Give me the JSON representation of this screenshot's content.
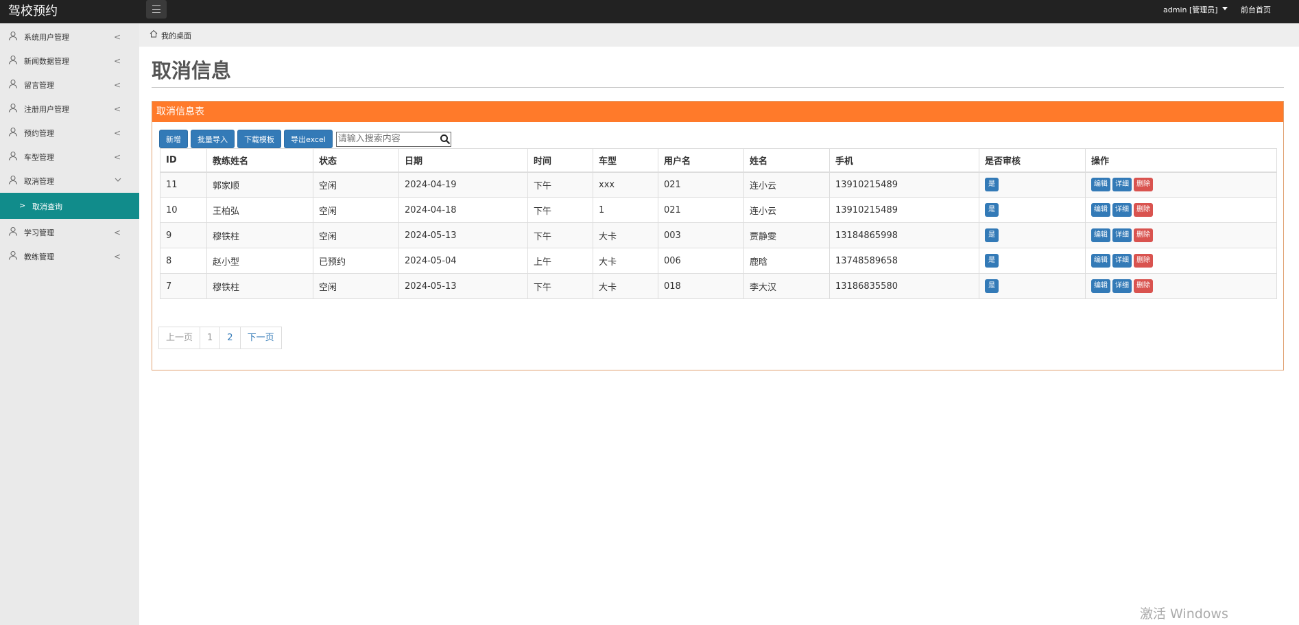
{
  "app": {
    "brand": "驾校预约"
  },
  "topbar": {
    "user": "admin [管理员]",
    "front_link": "前台首页"
  },
  "sidebar": {
    "items": [
      {
        "label": "系统用户管理"
      },
      {
        "label": "新闻数据管理"
      },
      {
        "label": "留言管理"
      },
      {
        "label": "注册用户管理"
      },
      {
        "label": "预约管理"
      },
      {
        "label": "车型管理"
      },
      {
        "label": "取消管理"
      },
      {
        "label": "学习管理"
      },
      {
        "label": "教练管理"
      }
    ],
    "sub_item": "取消查询"
  },
  "breadcrumb": {
    "home": "我的桌面"
  },
  "page": {
    "title": "取消信息"
  },
  "panel": {
    "heading": "取消信息表",
    "toolbar": {
      "add": "新增",
      "import": "批量导入",
      "template": "下载模板",
      "export": "导出excel"
    },
    "search": {
      "placeholder": "请输入搜索内容"
    }
  },
  "table": {
    "headers": [
      "ID",
      "教练姓名",
      "状态",
      "日期",
      "时间",
      "车型",
      "用户名",
      "姓名",
      "手机",
      "是否审核",
      "操作"
    ],
    "rows": [
      {
        "id": "11",
        "coach": "郭家顺",
        "status": "空闲",
        "date": "2024-04-19",
        "time": "下午",
        "car": "xxx",
        "username": "021",
        "name": "连小云",
        "phone": "13910215489",
        "approved": "是"
      },
      {
        "id": "10",
        "coach": "王柏弘",
        "status": "空闲",
        "date": "2024-04-18",
        "time": "下午",
        "car": "1",
        "username": "021",
        "name": "连小云",
        "phone": "13910215489",
        "approved": "是"
      },
      {
        "id": "9",
        "coach": "穆铁柱",
        "status": "空闲",
        "date": "2024-05-13",
        "time": "下午",
        "car": "大卡",
        "username": "003",
        "name": "贾静雯",
        "phone": "13184865998",
        "approved": "是"
      },
      {
        "id": "8",
        "coach": "赵小型",
        "status": "已预约",
        "date": "2024-05-04",
        "time": "上午",
        "car": "大卡",
        "username": "006",
        "name": "鹿晗",
        "phone": "13748589658",
        "approved": "是"
      },
      {
        "id": "7",
        "coach": "穆铁柱",
        "status": "空闲",
        "date": "2024-05-13",
        "time": "下午",
        "car": "大卡",
        "username": "018",
        "name": "李大汉",
        "phone": "13186835580",
        "approved": "是"
      }
    ],
    "actions": {
      "edit": "编辑",
      "detail": "详细",
      "delete": "删除"
    }
  },
  "pagination": {
    "prev": "上一页",
    "pages": [
      "1",
      "2"
    ],
    "next": "下一页"
  },
  "watermark": "激活 Windows"
}
